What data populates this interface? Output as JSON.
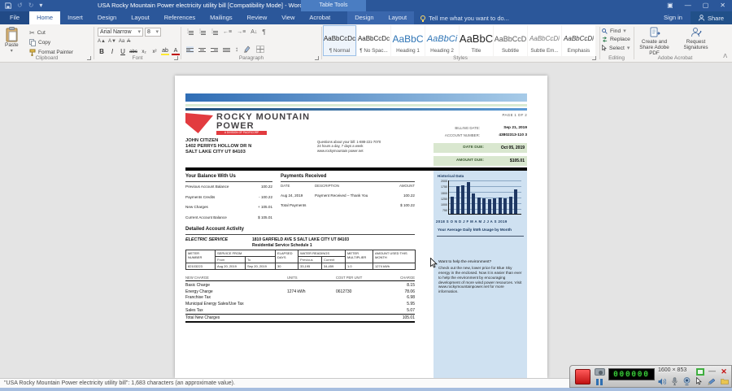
{
  "titlebar": {
    "title": "USA Rocky Mountain Power electricity utility bill [Compatibility Mode] - Word",
    "context_group": "Table Tools"
  },
  "menu": {
    "file": "File",
    "tabs": [
      "Home",
      "Insert",
      "Design",
      "Layout",
      "References",
      "Mailings",
      "Review",
      "View",
      "Acrobat"
    ],
    "table_tools_tabs": [
      "Design",
      "Layout"
    ],
    "tell_me": "Tell me what you want to do...",
    "sign_in": "Sign in",
    "share": "Share"
  },
  "icons": {
    "cut": "✂",
    "undo": "↺",
    "redo": "↻",
    "dropdown": "▾",
    "pilcrow": "¶",
    "grow_font": "A▲",
    "shrink_font": "A▼",
    "change_case": "Aa",
    "sort": "A↓",
    "line_spacing": "↕",
    "minimize": "—",
    "close": "✕",
    "maximize": "▢",
    "ribbon_opts": "▣",
    "collapse": "ᐱ"
  },
  "ribbon": {
    "clipboard": {
      "group": "Clipboard",
      "paste": "Paste",
      "cut": "Cut",
      "copy": "Copy",
      "format_painter": "Format Painter"
    },
    "font": {
      "group": "Font",
      "name": "Arial Narrow",
      "size": "8",
      "bold": "B",
      "italic": "I",
      "underline": "U",
      "strike": "abc",
      "sub": "x₂",
      "sup": "x²",
      "color_a": "A",
      "highlight": "ab"
    },
    "paragraph": {
      "group": "Paragraph"
    },
    "styles": {
      "group": "Styles",
      "items": [
        {
          "preview": "AaBbCcDc",
          "label": "¶ Normal"
        },
        {
          "preview": "AaBbCcDc",
          "label": "¶ No Spac..."
        },
        {
          "preview": "AaBbC",
          "label": "Heading 1"
        },
        {
          "preview": "AaBbCi",
          "label": "Heading 2"
        },
        {
          "preview": "AaBbC",
          "label": "Title"
        },
        {
          "preview": "AaBbCcD",
          "label": "Subtitle"
        },
        {
          "preview": "AaBbCcDi",
          "label": "Subtle Em..."
        },
        {
          "preview": "AaBbCcDi",
          "label": "Emphasis"
        }
      ]
    },
    "editing": {
      "group": "Editing",
      "find": "Find",
      "replace": "Replace",
      "select": "Select"
    },
    "acrobat": {
      "group": "Adobe Acrobat",
      "create_share": "Create and Share Adobe PDF",
      "request_signatures": "Request Signatures"
    }
  },
  "bill": {
    "brand": {
      "line1": "ROCKY MOUNTAIN",
      "line2": "POWER",
      "division": "A DIVISION OF PACIFICORP"
    },
    "page_label": "PAGE 1 OF 2",
    "billing_date_label": "BILLING DATE:",
    "billing_date": "Sep 21, 2019",
    "account_number_label": "ACCOUNT NUMBER:",
    "account_number": "43802313-110 3",
    "date_due_label": "DATE DUE:",
    "date_due": "Oct 05, 2019",
    "amount_due_label": "AMOUNT DUE:",
    "amount_due": "$105.01",
    "customer": {
      "name": "JOHN CITIZEN",
      "address1": "1402 PERRYS HOLLOW DR N",
      "address2": "SALT LAKE CITY UT 84103"
    },
    "questions": {
      "line1": "Questions about your bill: 1-888-221-7070",
      "line2": "24 hours a day, 7 days a week",
      "line3": "www.rockymountain power.net"
    },
    "balance": {
      "title": "Your Balance With Us",
      "rows": [
        {
          "label": "Previous Account Balance",
          "value": "100.22"
        },
        {
          "label": "Payments Credits",
          "value": "- 100.22"
        },
        {
          "label": "New Charges",
          "value": "+ 105.01"
        },
        {
          "label": "Current Account Balance",
          "value": "$ 105.01"
        }
      ]
    },
    "payments": {
      "title": "Payments Received",
      "col_date": "DATE",
      "col_desc": "DESCRIPTION",
      "col_amount": "AMOUNT",
      "row": {
        "date": "Aug 24, 2019",
        "description": "Payment Received – Thank You",
        "amount": "100.22"
      },
      "total_label": "Total Payments",
      "total": "$ 100.22"
    },
    "activity": {
      "title": "Detailed Account Activity",
      "service": "ELECTRIC SERVICE",
      "service_address": "1810 GARFIELD AVE S SALT LAKE CITY UT 84103",
      "schedule": "Residential Service Schedule 1",
      "meter": {
        "h_meter": "METER NUMBER",
        "h_service": "SERVICE FROM",
        "h_from": "From",
        "h_to": "To",
        "h_elapsed": "ELAPSED DAYS",
        "h_readings": "WATER READINGS",
        "h_prev": "Previous",
        "h_curr": "Current",
        "h_mult": "METER MULTIPLIER",
        "h_amount": "AMOUNT USED THIS MONTH",
        "meter_number": "82103223",
        "from": "Aug 20, 2019",
        "to": "Sep 20, 2019",
        "elapsed": "30",
        "previous": "33,195",
        "current": "34,459",
        "multiplier": "1.0",
        "amount_used": "1274 kWh"
      },
      "charges": {
        "h_name": "NEW CHARGE",
        "h_units": "UNITS",
        "h_cost": "COST PER UNIT",
        "h_charge": "CHARGE",
        "rows": [
          {
            "name": "Basic Charge",
            "units": "",
            "cost": "",
            "charge": "8.15"
          },
          {
            "name": "Energy Charge",
            "units": "1274 kWh",
            "cost": "0612730",
            "charge": "78.06"
          },
          {
            "name": "Franchise Tax",
            "units": "",
            "cost": "",
            "charge": "6.98"
          },
          {
            "name": "Municipal Energy Sales/Use Tax",
            "units": "",
            "cost": "",
            "charge": "5.95"
          },
          {
            "name": "Sales Tax",
            "units": "",
            "cost": "",
            "charge": "5.07"
          }
        ],
        "total_label": "Total New Charges",
        "total": "105.01"
      }
    },
    "sidebar": {
      "chart_title": "Historical Data",
      "x_axis": "2018 S O N D J F M A M J J A S 2019",
      "caption": "Your Average Daily kWh Usage by Month",
      "env_title": "Want to help the environment?",
      "env_body": "Check out the new, lower price for Blue Sky energy in the enclosed. Now it is easier than ever to help the environment by encouraging development of more wind power resources. Visit www.rockymountainpower.net for more information."
    }
  },
  "chart_data": {
    "type": "bar",
    "title": "Historical Data",
    "categories": [
      "S",
      "O",
      "N",
      "D",
      "J",
      "F",
      "M",
      "A",
      "M",
      "J",
      "J",
      "A",
      "S"
    ],
    "values": [
      1150,
      1800,
      1850,
      2100,
      1350,
      1050,
      1000,
      975,
      1000,
      1050,
      1000,
      1100,
      1600
    ],
    "xlabel": "Your Average Daily kWh Usage by Month",
    "ylabel": "kWh",
    "ylim": [
      0,
      2250
    ],
    "yticks": [
      2000,
      1750,
      1500,
      1250,
      1000,
      750
    ],
    "x_range_labels": [
      "2018",
      "2019"
    ],
    "legend": false,
    "grid": true
  },
  "statusbar": {
    "text": "\"USA Rocky Mountain Power electricity utility bill\": 1,683 characters (an approximate value)."
  },
  "recorder": {
    "timer": "000000",
    "resolution": "1600 × 853"
  }
}
